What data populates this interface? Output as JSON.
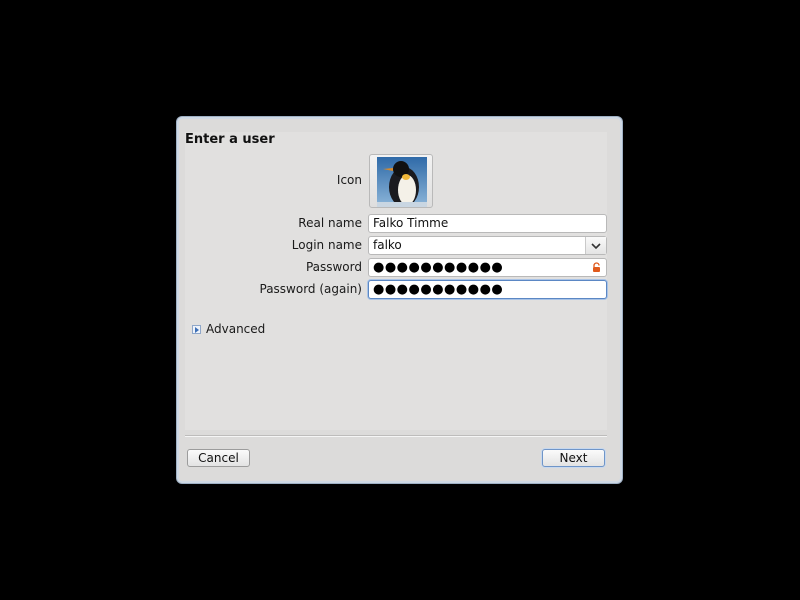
{
  "dialog": {
    "title": "Enter a user",
    "labels": {
      "icon": "Icon",
      "real_name": "Real name",
      "login_name": "Login name",
      "password": "Password",
      "password_again": "Password (again)"
    },
    "fields": {
      "real_name": "Falko Timme",
      "login_name": "falko",
      "password": "●●●●●●●●●●●",
      "password_again": "●●●●●●●●●●●"
    },
    "advanced_label": "Advanced",
    "buttons": {
      "cancel": "Cancel",
      "next": "Next"
    }
  },
  "icons": {
    "avatar": "penguin-icon",
    "dropdown": "chevron-down-icon",
    "lock": "lock-icon",
    "expander": "expand-arrow-icon"
  },
  "colors": {
    "background": "#000000",
    "dialog": "#dcdbda",
    "accent": "#5b87c4",
    "lock": "#e05a1c"
  }
}
